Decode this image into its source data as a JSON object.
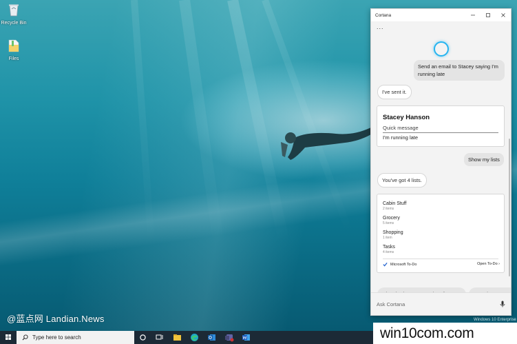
{
  "desktop": {
    "icons": [
      {
        "label": "Recycle Bin",
        "icon": "recycle-bin-icon"
      },
      {
        "label": "Files",
        "icon": "folder-icon"
      }
    ],
    "watermark": "@蓝点网 Landian.News",
    "edition_text": "Windows 10 Enterprise"
  },
  "taskbar": {
    "search_placeholder": "Type here to search",
    "icons": [
      "windows-start-icon",
      "search-icon",
      "cortana-circle-icon",
      "task-view-icon",
      "file-explorer-icon",
      "edge-icon",
      "outlook-icon",
      "teams-icon",
      "word-icon"
    ]
  },
  "cortana": {
    "title": "Cortana",
    "more": "...",
    "messages": {
      "user_1": "Send an email to Stacey saying I'm running late",
      "reply_1": "I've sent it.",
      "user_2": "Show my lists",
      "reply_2": "You've got 4 lists."
    },
    "email_card": {
      "name": "Stacey Hanson",
      "label": "Quick message",
      "message": "I'm running late"
    },
    "lists_card": {
      "lists": [
        {
          "name": "Cabin Stuff",
          "count": "2 items"
        },
        {
          "name": "Grocery",
          "count": "5 items"
        },
        {
          "name": "Shopping",
          "count": "1 item"
        },
        {
          "name": "Tasks",
          "count": "4 items"
        }
      ],
      "app_name": "Microsoft To-Do",
      "open_link": "Open To-Do ›"
    },
    "suggestions": [
      "What do I have on Monday afternoon?",
      "Cancel my 4 PM"
    ],
    "ask_placeholder": "Ask Cortana"
  },
  "overlay_watermark": "win10com.com",
  "colors": {
    "accent": "#25b4f0",
    "todo_check": "#2564cf"
  }
}
